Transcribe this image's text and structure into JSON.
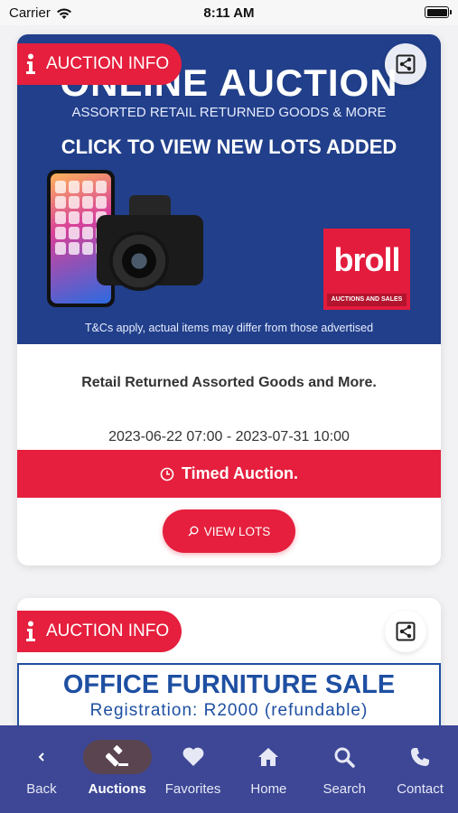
{
  "status_bar": {
    "carrier": "Carrier",
    "time": "8:11 AM"
  },
  "auctions": [
    {
      "info_label": "AUCTION INFO",
      "banner": {
        "headline": "ONLINE AUCTION",
        "subline": "ASSORTED RETAIL RETURNED GOODS & MORE",
        "cta": "CLICK TO VIEW NEW LOTS ADDED",
        "brand": "broll",
        "brand_tag": "AUCTIONS AND SALES",
        "disclaimer": "T&Cs apply, actual items may differ from those advertised"
      },
      "title": "Retail Returned Assorted Goods and More.",
      "dates": "2023-06-22 07:00 - 2023-07-31 10:00",
      "auction_type": "Timed Auction.",
      "view_label": "VIEW LOTS"
    },
    {
      "info_label": "AUCTION INFO",
      "banner": {
        "headline": "OFFICE FURNITURE SALE",
        "subline": "Registration: R2000 (refundable)"
      }
    }
  ],
  "tabbar": {
    "items": [
      {
        "label": "Back",
        "icon": "chevron-left-icon"
      },
      {
        "label": "Auctions",
        "icon": "gavel-icon",
        "active": true
      },
      {
        "label": "Favorites",
        "icon": "heart-icon"
      },
      {
        "label": "Home",
        "icon": "home-icon"
      },
      {
        "label": "Search",
        "icon": "search-icon"
      },
      {
        "label": "Contact",
        "icon": "phone-icon"
      }
    ]
  },
  "colors": {
    "accent_red": "#e51f3d",
    "navy": "#3d4795",
    "banner_blue": "#213f8a"
  }
}
